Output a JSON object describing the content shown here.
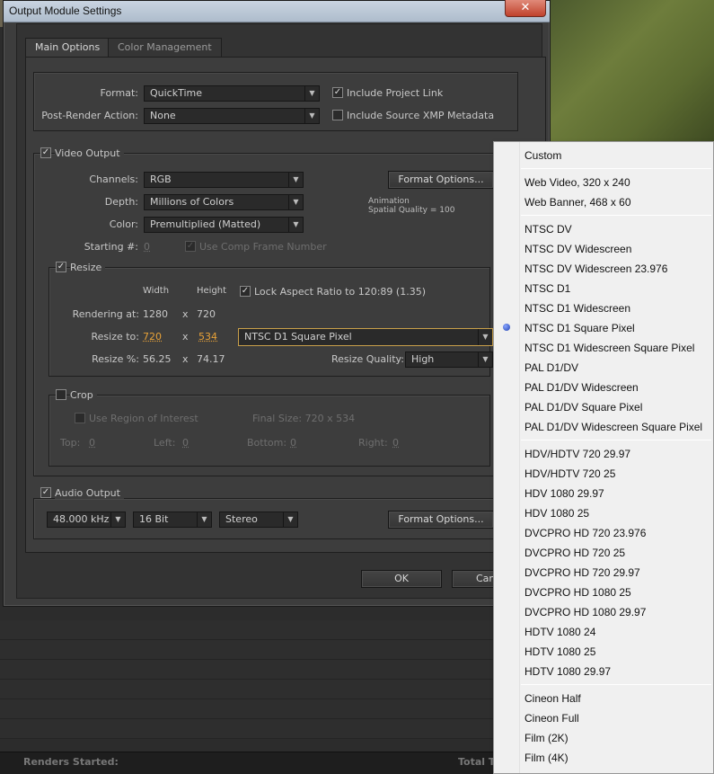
{
  "dialog": {
    "title": "Output Module Settings",
    "close_label": "✕",
    "tabs": [
      "Main Options",
      "Color Management"
    ]
  },
  "format_section": {
    "format_label": "Format:",
    "format_value": "QuickTime",
    "post_render_label": "Post-Render Action:",
    "post_render_value": "None",
    "include_project_link_label": "Include Project Link",
    "include_project_link_checked": true,
    "include_xmp_label": "Include Source XMP Metadata",
    "include_xmp_checked": false
  },
  "video_output": {
    "label": "Video Output",
    "checked": true,
    "channels_label": "Channels:",
    "channels_value": "RGB",
    "depth_label": "Depth:",
    "depth_value": "Millions of Colors",
    "color_label": "Color:",
    "color_value": "Premultiplied (Matted)",
    "starting_label": "Starting #:",
    "starting_value": "0",
    "use_comp_frame_label": "Use Comp Frame Number",
    "format_options_label": "Format Options...",
    "codec_info_line1": "Animation",
    "codec_info_line2": "Spatial Quality = 100"
  },
  "resize": {
    "label": "Resize",
    "checked": true,
    "width_header": "Width",
    "height_header": "Height",
    "lock_aspect_label": "Lock Aspect Ratio to 120:89 (1.35)",
    "lock_aspect_checked": true,
    "rendering_at_label": "Rendering at:",
    "rendering_w": "1280",
    "rendering_h": "720",
    "x": "x",
    "resize_to_label": "Resize to:",
    "resize_to_w": "720",
    "resize_to_h": "534",
    "preset_value": "NTSC D1 Square Pixel",
    "resize_pct_label": "Resize %:",
    "resize_pct_w": "56.25",
    "resize_pct_h": "74.17",
    "quality_label": "Resize Quality:",
    "quality_value": "High"
  },
  "crop": {
    "label": "Crop",
    "checked": false,
    "use_roi_label": "Use Region of Interest",
    "final_size_label": "Final Size: 720 x 534",
    "top_label": "Top:",
    "top_value": "0",
    "left_label": "Left:",
    "left_value": "0",
    "bottom_label": "Bottom:",
    "bottom_value": "0",
    "right_label": "Right:",
    "right_value": "0"
  },
  "audio_output": {
    "label": "Audio Output",
    "checked": true,
    "rate_value": "48.000 kHz",
    "bits_value": "16 Bit",
    "channels_value": "Stereo",
    "format_options_label": "Format Options..."
  },
  "footer": {
    "ok_label": "OK",
    "cancel_label": "Can"
  },
  "background": {
    "renders_started_label": "Renders Started:",
    "total_label": "Total T"
  },
  "preset_menu": {
    "selected": "NTSC D1 Square Pixel",
    "groups": [
      [
        "Custom"
      ],
      [
        "Web Video, 320 x 240",
        "Web Banner, 468 x 60"
      ],
      [
        "NTSC DV",
        "NTSC DV Widescreen",
        "NTSC DV Widescreen 23.976",
        "NTSC D1",
        "NTSC D1 Widescreen",
        "NTSC D1 Square Pixel",
        "NTSC D1 Widescreen Square Pixel",
        "PAL D1/DV",
        "PAL D1/DV Widescreen",
        "PAL D1/DV Square Pixel",
        "PAL D1/DV Widescreen Square Pixel"
      ],
      [
        "HDV/HDTV 720 29.97",
        "HDV/HDTV 720 25",
        "HDV 1080 29.97",
        "HDV 1080 25",
        "DVCPRO HD 720 23.976",
        "DVCPRO HD 720 25",
        "DVCPRO HD 720 29.97",
        "DVCPRO HD 1080 25",
        "DVCPRO HD 1080 29.97",
        "HDTV 1080 24",
        "HDTV 1080 25",
        "HDTV 1080 29.97"
      ],
      [
        "Cineon Half",
        "Cineon Full",
        "Film (2K)",
        "Film (4K)"
      ]
    ]
  }
}
